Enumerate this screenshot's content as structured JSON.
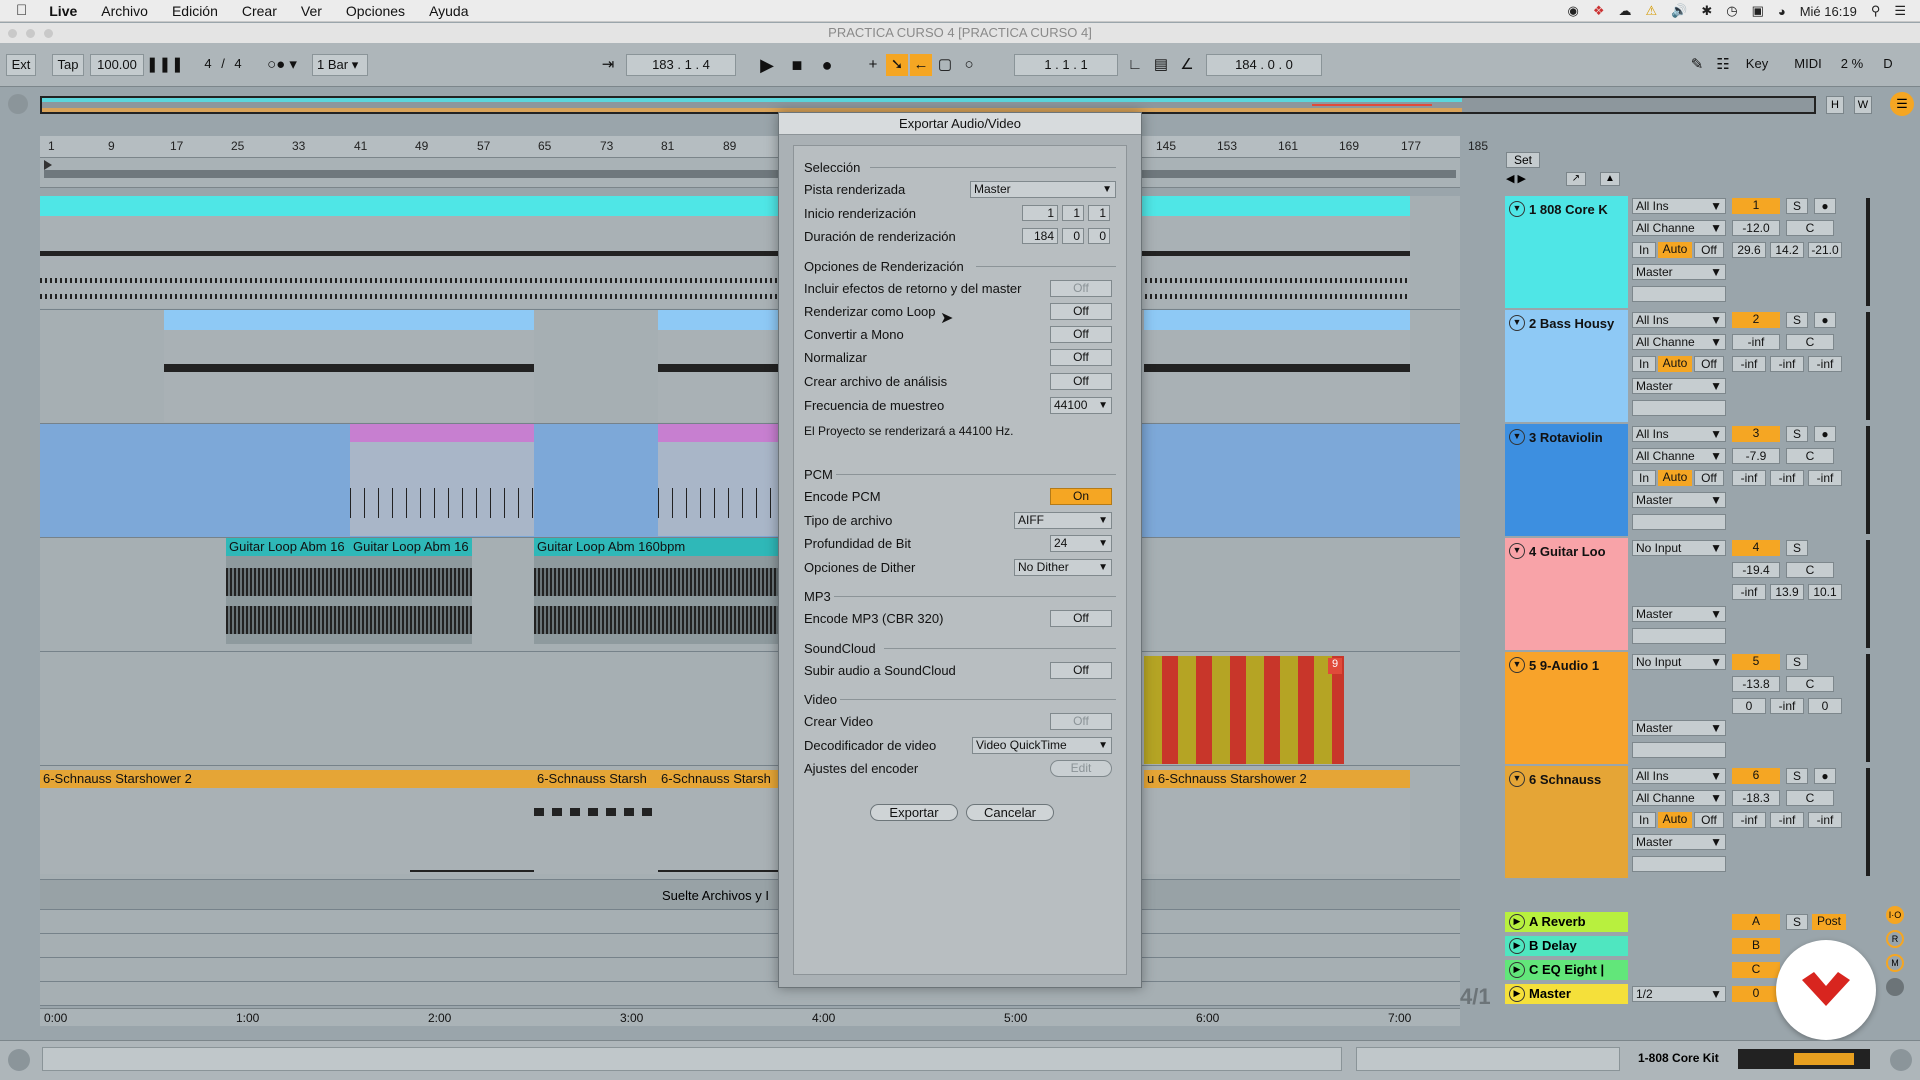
{
  "menubar": {
    "app": "Live",
    "items": [
      "Archivo",
      "Edición",
      "Crear",
      "Ver",
      "Opciones",
      "Ayuda"
    ],
    "clock": "Mié 16:19"
  },
  "window_title": "PRACTICA CURSO 4  [PRACTICA CURSO 4]",
  "transport": {
    "ext": "Ext",
    "tap": "Tap",
    "tempo": "100.00",
    "signature_num": "4",
    "signature_den": "4",
    "quantize": "1 Bar",
    "position": "183 .  1 .  4",
    "loop_start": "1 .  1 .  1",
    "loop_length": "184 .  0 .  0",
    "key": "Key",
    "midi": "MIDI",
    "cpu": "2 %",
    "d": "D"
  },
  "ruler_labels": [
    "1",
    "9",
    "17",
    "25",
    "33",
    "41",
    "49",
    "57",
    "65",
    "73",
    "81",
    "89",
    "145",
    "153",
    "161",
    "169",
    "177",
    "185"
  ],
  "time_labels": [
    "0:00",
    "1:00",
    "2:00",
    "3:00",
    "4:00",
    "5:00",
    "6:00",
    "7:00"
  ],
  "clips": {
    "guitar1": "Guitar Loop Abm 16",
    "guitar2": "Guitar Loop Abm 16",
    "guitar3": "Guitar Loop Abm 160bpm",
    "schnauss1": "6-Schnauss Starshower 2",
    "schnauss2": "6-Schnauss Starsh",
    "schnauss3": "6-Schnauss Starsh",
    "schnauss4": "6-Schnauss Starshower 2",
    "schnauss4_prefix": "u",
    "drop_hint": "Suelte Archivos y I",
    "audio_marker": "9"
  },
  "mixer": {
    "set_label": "Set",
    "tracks": [
      {
        "name": "1 808 Core K",
        "input": "All Ins",
        "channel": "All Channe",
        "num": "1",
        "vol": "-12.0",
        "pan": "C",
        "a": "29.6",
        "b": "14.2",
        "c": "-21.0",
        "out": "Master",
        "color": "#4fe6e6"
      },
      {
        "name": "2 Bass Housy",
        "input": "All Ins",
        "channel": "All Channe",
        "num": "2",
        "vol": "-inf",
        "pan": "C",
        "a": "-inf",
        "b": "-inf",
        "c": "-inf",
        "out": "Master",
        "color": "#8ec9f5"
      },
      {
        "name": "3 Rotaviolin",
        "input": "All Ins",
        "channel": "All Channe",
        "num": "3",
        "vol": "-7.9",
        "pan": "C",
        "a": "-inf",
        "b": "-inf",
        "c": "-inf",
        "out": "Master",
        "color": "#3d8fe0"
      },
      {
        "name": "4 Guitar Loo",
        "input": "No Input",
        "channel": "",
        "num": "4",
        "vol": "-19.4",
        "pan": "C",
        "a": "-inf",
        "b": "13.9",
        "c": "10.1",
        "out": "Master",
        "color": "#f8a3a8"
      },
      {
        "name": "5 9-Audio 1",
        "input": "No Input",
        "channel": "",
        "num": "5",
        "vol": "-13.8",
        "pan": "C",
        "a": "0",
        "b": "-inf",
        "c": "0",
        "out": "Master",
        "color": "#f8a32a"
      },
      {
        "name": "6 Schnauss",
        "input": "All Ins",
        "channel": "All Channe",
        "num": "6",
        "vol": "-18.3",
        "pan": "C",
        "a": "-inf",
        "b": "-inf",
        "c": "-inf",
        "out": "Master",
        "color": "#e5a536"
      }
    ],
    "in_label": "In",
    "auto_label": "Auto",
    "off_label": "Off",
    "s_label": "S",
    "returns": [
      {
        "name": "A Reverb",
        "letter": "A",
        "post": "Post"
      },
      {
        "name": "B Delay",
        "letter": "B"
      },
      {
        "name": "C EQ Eight |",
        "letter": "C"
      }
    ],
    "master": {
      "name": "Master",
      "out": "1/2",
      "num": "0"
    },
    "ratio": "4/1"
  },
  "dialog": {
    "title": "Exportar Audio/Video",
    "sec_seleccion": "Selección",
    "pista_label": "Pista renderizada",
    "pista_value": "Master",
    "inicio_label": "Inicio renderización",
    "inicio_values": [
      "1",
      "1",
      "1"
    ],
    "duracion_label": "Duración de renderización",
    "duracion_values": [
      "184",
      "0",
      "0"
    ],
    "sec_opciones": "Opciones de Renderización",
    "incluir_label": "Incluir efectos de retorno y del master",
    "incluir_value": "Off",
    "loop_label": "Renderizar como Loop",
    "loop_value": "Off",
    "mono_label": "Convertir a Mono",
    "mono_value": "Off",
    "normalizar_label": "Normalizar",
    "normalizar_value": "Off",
    "analisis_label": "Crear archivo de análisis",
    "analisis_value": "Off",
    "frecuencia_label": "Frecuencia de muestreo",
    "frecuencia_value": "44100",
    "proyecto_note": "El Proyecto se  renderizará a 44100 Hz.",
    "sec_pcm": "PCM",
    "encode_pcm_label": "Encode PCM",
    "encode_pcm_value": "On",
    "tipo_label": "Tipo de archivo",
    "tipo_value": "AIFF",
    "bit_label": "Profundidad de Bit",
    "bit_value": "24",
    "dither_label": "Opciones de Dither",
    "dither_value": "No Dither",
    "sec_mp3": "MP3",
    "encode_mp3_label": "Encode MP3 (CBR 320)",
    "encode_mp3_value": "Off",
    "sec_soundcloud": "SoundCloud",
    "subir_label": "Subir audio a SoundCloud",
    "subir_value": "Off",
    "sec_video": "Video",
    "crear_video_label": "Crear Video",
    "crear_video_value": "Off",
    "decodificador_label": "Decodificador de video",
    "decodificador_value": "Video QuickTime",
    "ajustes_label": "Ajustes del encoder",
    "ajustes_value": "Edit",
    "exportar": "Exportar",
    "cancelar": "Cancelar"
  },
  "status": {
    "track_name": "1-808 Core Kit"
  }
}
